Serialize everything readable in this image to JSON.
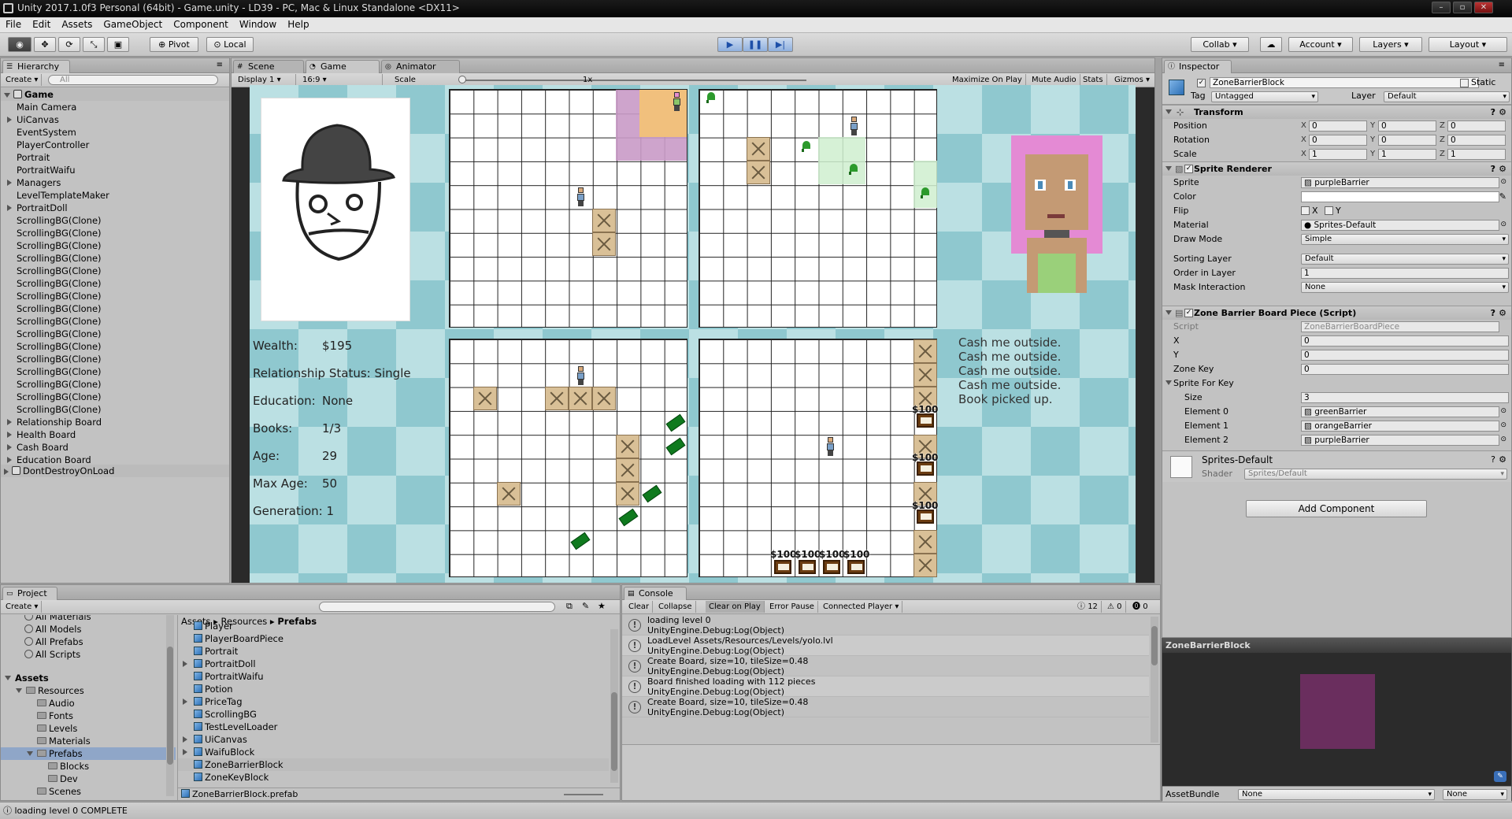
{
  "window": {
    "title": "Unity 2017.1.0f3 Personal (64bit) - Game.unity - LD39 - PC, Mac & Linux Standalone <DX11>",
    "controls": [
      "–",
      "▫",
      "✕"
    ]
  },
  "menu": [
    "File",
    "Edit",
    "Assets",
    "GameObject",
    "Component",
    "Window",
    "Help"
  ],
  "toolbar": {
    "pivot": "Pivot",
    "local": "Local",
    "collab": "Collab ▾",
    "account": "Account",
    "layers": "Layers",
    "layout": "Layout"
  },
  "hierarchy": {
    "tab": "Hierarchy",
    "create": "Create ▾",
    "search": "All",
    "scene": "Game",
    "items": [
      {
        "label": "Main Camera",
        "arrow": ""
      },
      {
        "label": "UiCanvas",
        "arrow": "right"
      },
      {
        "label": "EventSystem",
        "arrow": ""
      },
      {
        "label": "PlayerController",
        "arrow": ""
      },
      {
        "label": "Portrait",
        "arrow": ""
      },
      {
        "label": "PortraitWaifu",
        "arrow": ""
      },
      {
        "label": "Managers",
        "arrow": "right"
      },
      {
        "label": "LevelTemplateMaker",
        "arrow": ""
      },
      {
        "label": "PortraitDoll",
        "arrow": "right"
      },
      {
        "label": "ScrollingBG(Clone)",
        "arrow": ""
      },
      {
        "label": "ScrollingBG(Clone)",
        "arrow": ""
      },
      {
        "label": "ScrollingBG(Clone)",
        "arrow": ""
      },
      {
        "label": "ScrollingBG(Clone)",
        "arrow": ""
      },
      {
        "label": "ScrollingBG(Clone)",
        "arrow": ""
      },
      {
        "label": "ScrollingBG(Clone)",
        "arrow": ""
      },
      {
        "label": "ScrollingBG(Clone)",
        "arrow": ""
      },
      {
        "label": "ScrollingBG(Clone)",
        "arrow": ""
      },
      {
        "label": "ScrollingBG(Clone)",
        "arrow": ""
      },
      {
        "label": "ScrollingBG(Clone)",
        "arrow": ""
      },
      {
        "label": "ScrollingBG(Clone)",
        "arrow": ""
      },
      {
        "label": "ScrollingBG(Clone)",
        "arrow": ""
      },
      {
        "label": "ScrollingBG(Clone)",
        "arrow": ""
      },
      {
        "label": "ScrollingBG(Clone)",
        "arrow": ""
      },
      {
        "label": "ScrollingBG(Clone)",
        "arrow": ""
      },
      {
        "label": "ScrollingBG(Clone)",
        "arrow": ""
      },
      {
        "label": "Relationship Board",
        "arrow": "right"
      },
      {
        "label": "Health Board",
        "arrow": "right"
      },
      {
        "label": "Cash Board",
        "arrow": "right"
      },
      {
        "label": "Education Board",
        "arrow": "right"
      }
    ],
    "dontdestroy": "DontDestroyOnLoad"
  },
  "gameview": {
    "tabs": [
      "Scene",
      "Game",
      "Animator"
    ],
    "display": "Display 1",
    "aspect": "16:9",
    "scale_label": "Scale",
    "scale_value": "1x",
    "buttons": [
      "Maximize On Play",
      "Mute Audio",
      "Stats",
      "Gizmos ▾"
    ],
    "stats": [
      {
        "label": "Wealth:",
        "value": "$195"
      },
      {
        "label": "Relationship Status:",
        "value": "Single"
      },
      {
        "label": "Education:",
        "value": "None"
      },
      {
        "label": "Books:",
        "value": "1/3"
      },
      {
        "label": "Age:",
        "value": "29"
      },
      {
        "label": "Max Age:",
        "value": "50"
      },
      {
        "label": "Generation:",
        "value": "1"
      }
    ],
    "messages": [
      "Cash me outside.",
      "Cash me outside.",
      "Cash me outside.",
      "Cash me outside.",
      "Book picked up."
    ],
    "price_tag": "$100"
  },
  "inspector": {
    "tab": "Inspector",
    "object_name": "ZoneBarrierBlock",
    "static_label": "Static",
    "tag_label": "Tag",
    "tag_value": "Untagged",
    "layer_label": "Layer",
    "layer_value": "Default",
    "transform": {
      "title": "Transform",
      "rows": [
        {
          "label": "Position",
          "x": "0",
          "y": "0",
          "z": "0"
        },
        {
          "label": "Rotation",
          "x": "0",
          "y": "0",
          "z": "0"
        },
        {
          "label": "Scale",
          "x": "1",
          "y": "1",
          "z": "1"
        }
      ]
    },
    "sprite_renderer": {
      "title": "Sprite Renderer",
      "sprite_label": "Sprite",
      "sprite": "purpleBarrier",
      "color_label": "Color",
      "flip_label": "Flip",
      "flip_x": "X",
      "flip_y": "Y",
      "material_label": "Material",
      "material": "Sprites-Default",
      "drawmode_label": "Draw Mode",
      "drawmode": "Simple",
      "sortinglayer_label": "Sorting Layer",
      "sortinglayer": "Default",
      "order_label": "Order in Layer",
      "order": "1",
      "mask_label": "Mask Interaction",
      "mask": "None"
    },
    "script": {
      "title": "Zone Barrier Board Piece (Script)",
      "script_label": "Script",
      "script": "ZoneBarrierBoardPiece",
      "x_label": "X",
      "x": "0",
      "y_label": "Y",
      "y": "0",
      "zonekey_label": "Zone Key",
      "zonekey": "0",
      "sfk_label": "Sprite For Key",
      "size_label": "Size",
      "size": "3",
      "elements": [
        {
          "label": "Element 0",
          "value": "greenBarrier"
        },
        {
          "label": "Element 1",
          "value": "orangeBarrier"
        },
        {
          "label": "Element 2",
          "value": "purpleBarrier"
        }
      ]
    },
    "material_block": {
      "name": "Sprites-Default",
      "shader_label": "Shader",
      "shader": "Sprites/Default"
    },
    "add_component": "Add Component",
    "preview_title": "ZoneBarrierBlock",
    "assetbundle_label": "AssetBundle",
    "assetbundle": "None",
    "assetbundle_variant": "None"
  },
  "project": {
    "tab": "Project",
    "create": "Create ▾",
    "favorites": [
      "All Materials",
      "All Models",
      "All Prefabs",
      "All Scripts"
    ],
    "tree": [
      {
        "label": "Assets",
        "indent": 0,
        "arrow": "down",
        "bold": true
      },
      {
        "label": "Resources",
        "indent": 1,
        "arrow": "down"
      },
      {
        "label": "Audio",
        "indent": 2,
        "arrow": ""
      },
      {
        "label": "Fonts",
        "indent": 2,
        "arrow": ""
      },
      {
        "label": "Levels",
        "indent": 2,
        "arrow": ""
      },
      {
        "label": "Materials",
        "indent": 2,
        "arrow": ""
      },
      {
        "label": "Prefabs",
        "indent": 2,
        "arrow": "down",
        "selected": true
      },
      {
        "label": "Blocks",
        "indent": 3,
        "arrow": ""
      },
      {
        "label": "Dev",
        "indent": 3,
        "arrow": ""
      },
      {
        "label": "Scenes",
        "indent": 2,
        "arrow": ""
      }
    ],
    "breadcrumb": [
      "Assets",
      "Resources",
      "Prefabs"
    ],
    "files": [
      {
        "label": "Player",
        "arrow": ""
      },
      {
        "label": "PlayerBoardPiece",
        "arrow": ""
      },
      {
        "label": "Portrait",
        "arrow": ""
      },
      {
        "label": "PortraitDoll",
        "arrow": "right"
      },
      {
        "label": "PortraitWaifu",
        "arrow": ""
      },
      {
        "label": "Potion",
        "arrow": ""
      },
      {
        "label": "PriceTag",
        "arrow": "right"
      },
      {
        "label": "ScrollingBG",
        "arrow": ""
      },
      {
        "label": "TestLevelLoader",
        "arrow": ""
      },
      {
        "label": "UiCanvas",
        "arrow": "right"
      },
      {
        "label": "WaifuBlock",
        "arrow": "right"
      },
      {
        "label": "ZoneBarrierBlock",
        "arrow": "",
        "selected": true
      },
      {
        "label": "ZoneKeyBlock",
        "arrow": ""
      }
    ],
    "footer_file": "ZoneBarrierBlock.prefab"
  },
  "console": {
    "tab": "Console",
    "buttons": [
      "Clear",
      "Collapse",
      "Clear on Play",
      "Error Pause",
      "Connected Player ▾"
    ],
    "counts": {
      "info": "12",
      "warn": "0",
      "error": "0"
    },
    "lines": [
      {
        "msg": "loading level 0",
        "src": "UnityEngine.Debug:Log(Object)"
      },
      {
        "msg": "LoadLevel Assets/Resources/Levels/yolo.lvl",
        "src": "UnityEngine.Debug:Log(Object)"
      },
      {
        "msg": "Create Board, size=10, tileSize=0.48",
        "src": "UnityEngine.Debug:Log(Object)"
      },
      {
        "msg": "Board finished loading with 112 pieces",
        "src": "UnityEngine.Debug:Log(Object)"
      },
      {
        "msg": "Create Board, size=10, tileSize=0.48",
        "src": "UnityEngine.Debug:Log(Object)"
      }
    ]
  },
  "statusbar": "loading level 0 COMPLETE",
  "colors": {
    "accent": "#3d6fb8",
    "selection": "#8fa6c8",
    "checker_light": "#bbe0e3",
    "checker_dark": "#8fc8cf"
  }
}
